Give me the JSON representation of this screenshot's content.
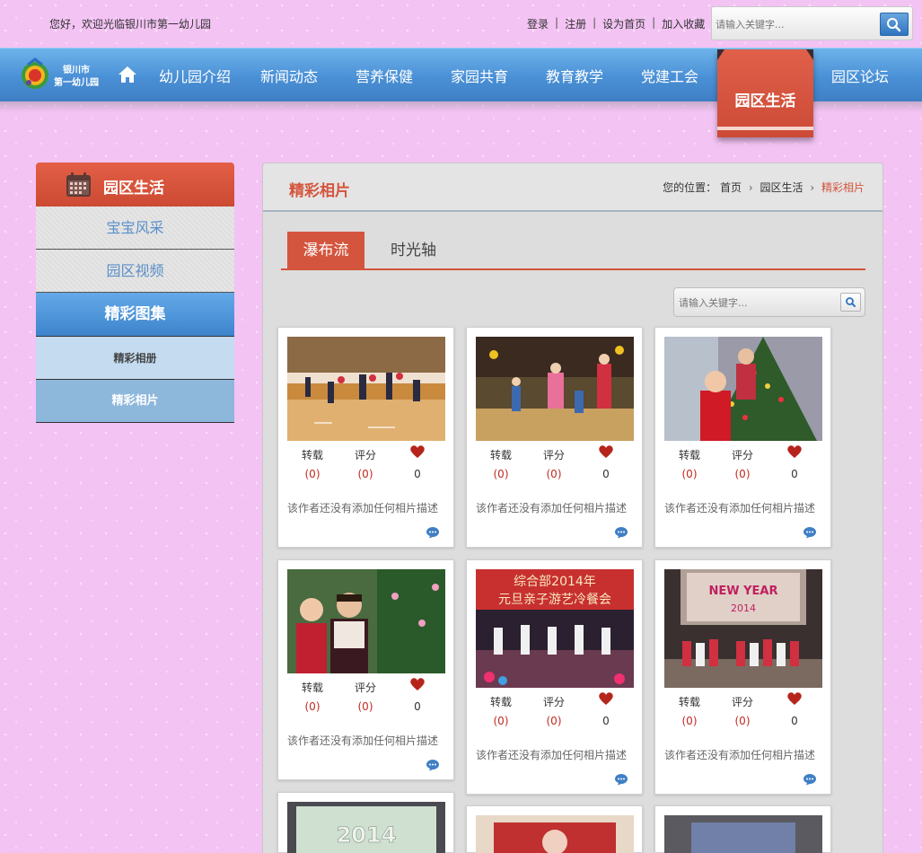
{
  "topbar": {
    "welcome": "您好，欢迎光临银川市第一幼儿园",
    "links": [
      "登录",
      "注册",
      "设为首页",
      "加入收藏"
    ],
    "search_placeholder": "请输入关键字..."
  },
  "logo": {
    "line1": "银川市",
    "line2": "第一幼儿园"
  },
  "nav": {
    "items": [
      "幼儿园介绍",
      "新闻动态",
      "营养保健",
      "家园共育",
      "教育教学",
      "党建工会",
      "园区生活",
      "园区论坛"
    ],
    "active_index": 6
  },
  "sidebar": {
    "title": "园区生活",
    "links": [
      "宝宝风采",
      "园区视频"
    ],
    "section": "精彩图集",
    "subitems": [
      "精彩相册",
      "精彩相片"
    ]
  },
  "panel": {
    "title": "精彩相片",
    "breadcrumb": {
      "prefix": "您的位置：",
      "items": [
        "首页",
        "园区生活",
        "精彩相片"
      ]
    },
    "tabs": [
      "瀑布流",
      "时光轴"
    ],
    "search_placeholder": "请输入关键字..."
  },
  "cards": [
    {
      "repost_label": "转载",
      "rate_label": "评分",
      "repost": "(0)",
      "rate": "(0)",
      "likes": "0",
      "desc": "该作者还没有添加任何相片描述",
      "photo": "dance-hall"
    },
    {
      "repost_label": "转载",
      "rate_label": "评分",
      "repost": "(0)",
      "rate": "(0)",
      "likes": "0",
      "desc": "该作者还没有添加任何相片描述",
      "photo": "dancing-children"
    },
    {
      "repost_label": "转载",
      "rate_label": "评分",
      "repost": "(0)",
      "rate": "(0)",
      "likes": "0",
      "desc": "该作者还没有添加任何相片描述",
      "photo": "christmas-tree"
    },
    {
      "repost_label": "转载",
      "rate_label": "评分",
      "repost": "(0)",
      "rate": "(0)",
      "likes": "0",
      "desc": "该作者还没有添加任何相片描述",
      "photo": "girls-tree"
    },
    {
      "repost_label": "转载",
      "rate_label": "评分",
      "repost": "(0)",
      "rate": "(0)",
      "likes": "0",
      "desc": "该作者还没有添加任何相片描述",
      "photo": "stage-banner",
      "banner_line1": "综合部2014年",
      "banner_line2": "元旦亲子游艺冷餐会"
    },
    {
      "repost_label": "转载",
      "rate_label": "评分",
      "repost": "(0)",
      "rate": "(0)",
      "likes": "0",
      "desc": "该作者还没有添加任何相片描述",
      "photo": "new-year-stage",
      "screen_text": "NEW YEAR",
      "screen_year": "2014"
    },
    {
      "photo": "screen-2014",
      "screen_year": "2014"
    },
    {
      "photo": "red-screen"
    },
    {
      "photo": "hall-screen"
    }
  ],
  "colors": {
    "brand_red": "#d4553d",
    "nav_blue": "#4a90d6",
    "page_pink": "#f3c3f3"
  }
}
